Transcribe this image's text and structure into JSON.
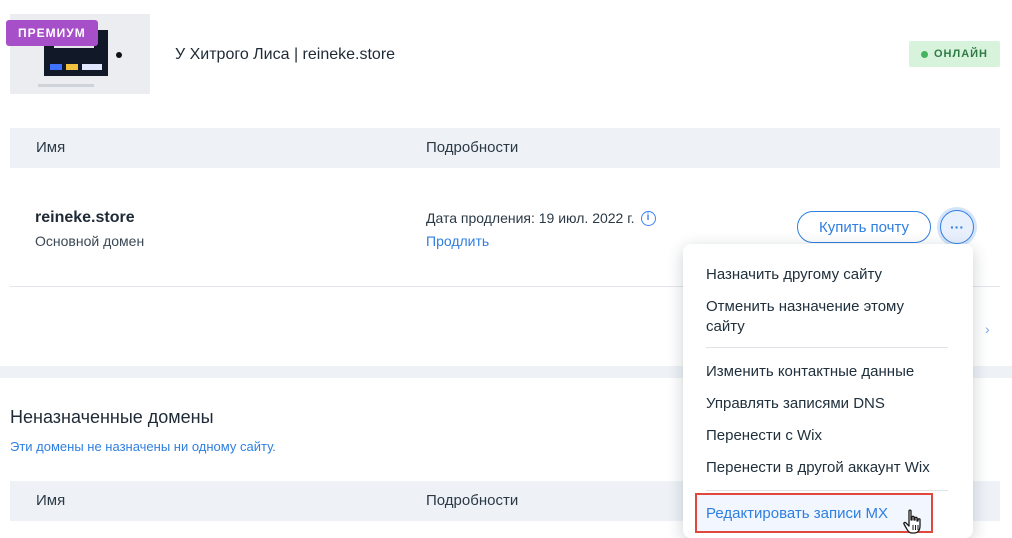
{
  "site": {
    "title": "У Хитрого Лиса | reineke.store",
    "premium_badge": "ПРЕМИУМ",
    "status_badge": "ОНЛАЙН"
  },
  "table": {
    "headers": [
      "Имя",
      "Подробности"
    ]
  },
  "domain": {
    "name": "reineke.store",
    "type": "Основной домен",
    "renewal": "Дата продления: 19 июл. 2022 г.",
    "renew_link": "Продлить",
    "buy_mail_label": "Купить почту",
    "more_label": "···"
  },
  "unassigned": {
    "title": "Неназначенные домены",
    "subtitle": "Эти домены не назначены ни одному сайту.",
    "headers": [
      "Имя",
      "Подробности"
    ]
  },
  "menu": {
    "items": [
      "Назначить другому сайту",
      "Отменить назначение этому сайту",
      "Изменить контактные данные",
      "Управлять записями DNS",
      "Перенести с Wix",
      "Перенести в другой аккаунт Wix",
      "Редактировать записи MX"
    ]
  },
  "colors": {
    "accent": "#2f7fe0",
    "premium": "#a64fc8",
    "online_bg": "#d8f3dc",
    "highlight_border": "#e0483e"
  },
  "icons": [
    "info-icon",
    "more-icon",
    "chevron-right-icon",
    "hand-cursor-icon"
  ]
}
